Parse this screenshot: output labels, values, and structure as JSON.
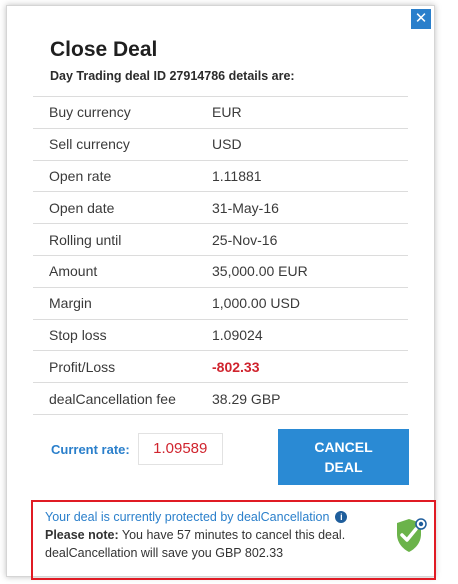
{
  "dialog": {
    "close_symbol": "✕",
    "title": "Close Deal",
    "subtitle": "Day Trading deal ID 27914786 details are:"
  },
  "details": [
    {
      "label": "Buy currency",
      "value": "EUR"
    },
    {
      "label": "Sell currency",
      "value": "USD"
    },
    {
      "label": "Open rate",
      "value": "1.11881"
    },
    {
      "label": "Open date",
      "value": "31-May-16"
    },
    {
      "label": "Rolling until",
      "value": "25-Nov-16"
    },
    {
      "label": "Amount",
      "value": "35,000.00 EUR"
    },
    {
      "label": "Margin",
      "value": "1,000.00 USD"
    },
    {
      "label": "Stop loss",
      "value": "1.09024"
    },
    {
      "label": "Profit/Loss",
      "value": "-802.33"
    },
    {
      "label": "dealCancellation fee",
      "value": "38.29 GBP"
    }
  ],
  "current_rate": {
    "label": "Current rate:",
    "value": "1.09589"
  },
  "cancel_button": {
    "line1": "CANCEL",
    "line2": "DEAL"
  },
  "notice": {
    "headline": "Your deal is currently protected by dealCancellation",
    "info_icon": "info-icon",
    "note_label": "Please note:",
    "note_text": " You have 57 minutes to cancel this deal.",
    "savings_text": "dealCancellation will save you GBP  802.33",
    "badge_icon": "shield-check-icon"
  },
  "colors": {
    "accent": "#2a7fcb",
    "button": "#2a8ad4",
    "loss": "#d0242e",
    "alert_border": "#e01b24",
    "shield_green": "#6bb34a"
  }
}
